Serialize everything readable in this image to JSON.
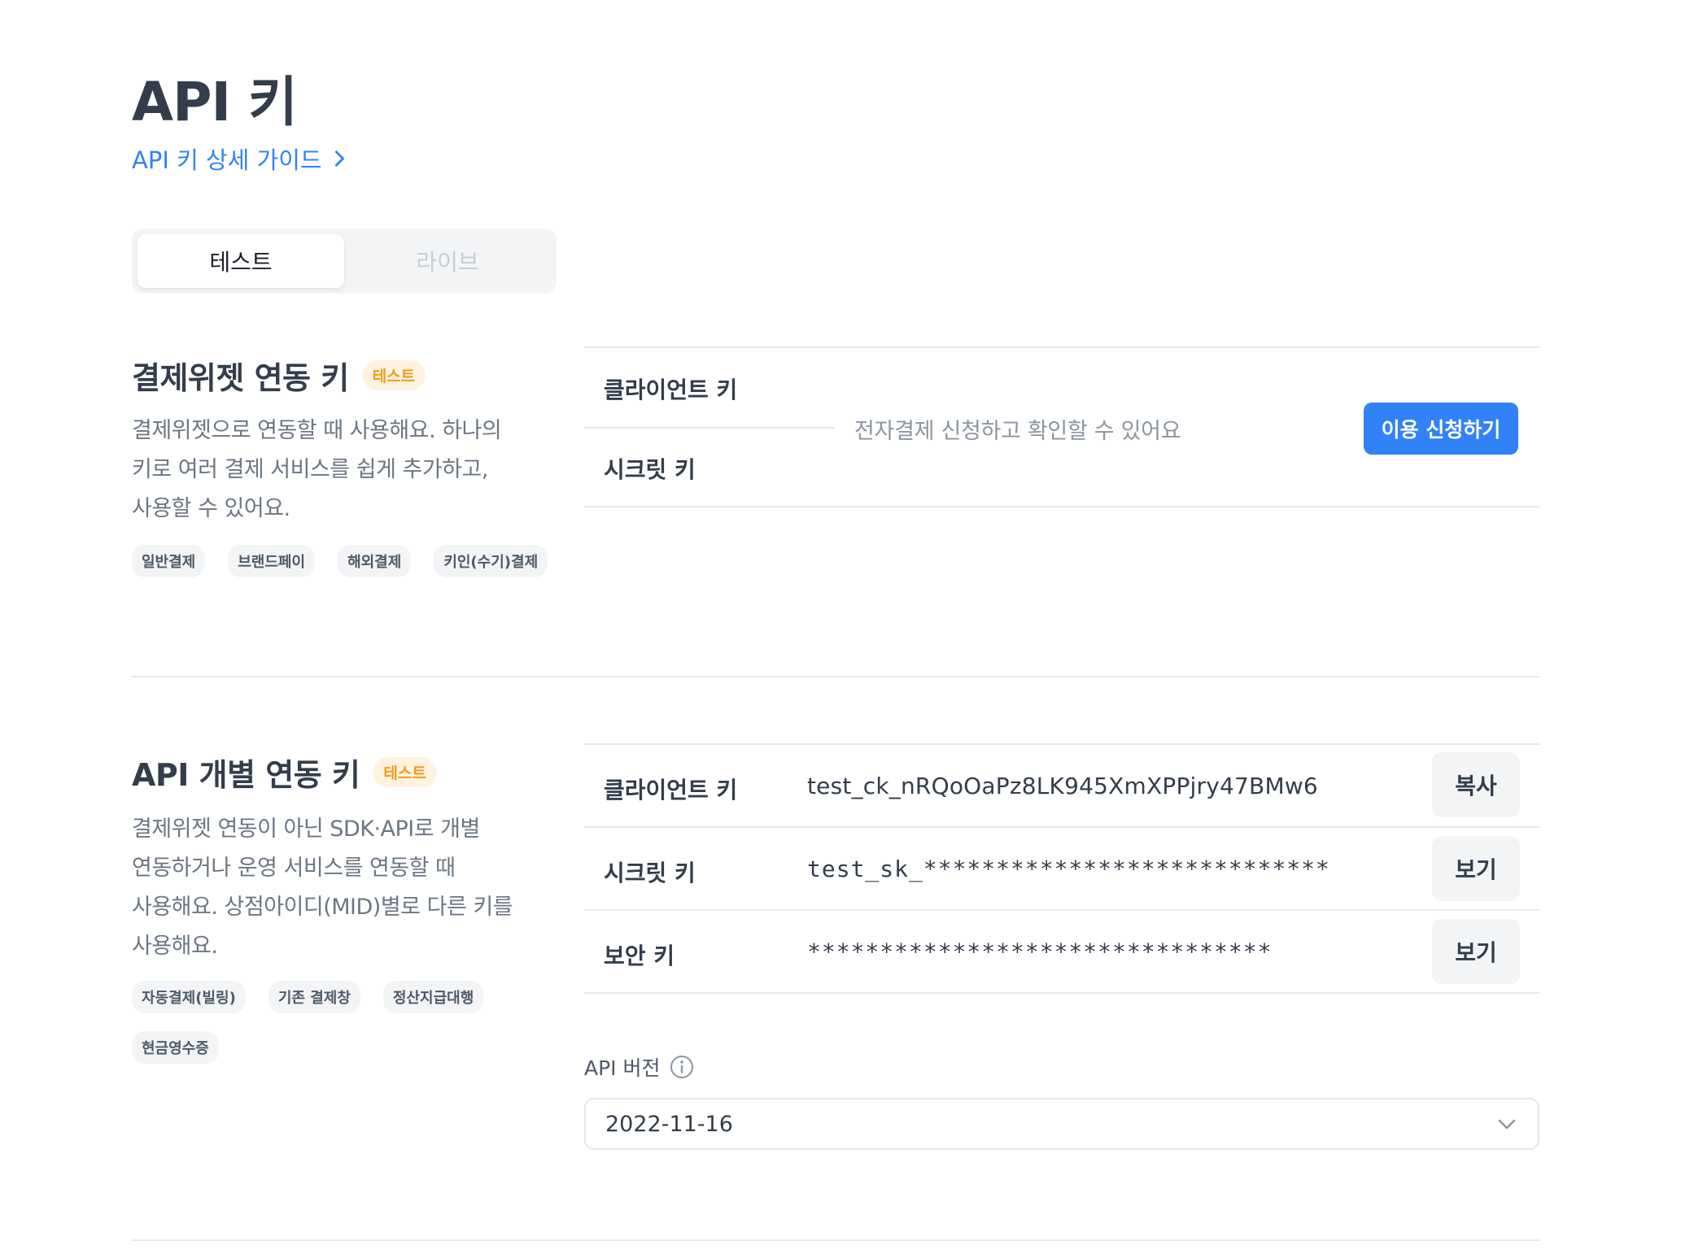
{
  "header": {
    "title": "API 키",
    "guide_link": "API 키 상세 가이드"
  },
  "env_tabs": {
    "test": "테스트",
    "live": "라이브"
  },
  "widget_section": {
    "title": "결제위젯 연동 키",
    "badge": "테스트",
    "description_lines": [
      "결제위젯으로 연동할 때 사용해요. 하나의",
      "키로 여러 결제 서비스를 쉽게 추가하고,",
      "사용할 수 있어요."
    ],
    "chips": [
      "일반결제",
      "브랜드페이",
      "해외결제",
      "키인(수기)결제"
    ],
    "client_key_label": "클라이언트 키",
    "secret_key_label": "시크릿 키",
    "notice": "전자결제 신청하고 확인할 수 있어요",
    "apply_button": "이용 신청하기"
  },
  "api_section": {
    "title": "API 개별 연동 키",
    "badge": "테스트",
    "description_lines": [
      "결제위젯 연동이 아닌 SDK·API로 개별",
      "연동하거나 운영 서비스를 연동할 때",
      "사용해요. 상점아이디(MID)별로 다른 키를",
      "사용해요."
    ],
    "chips": [
      "자동결제(빌링)",
      "기존 결제창",
      "정산지급대행",
      "현금영수증"
    ],
    "rows": [
      {
        "label": "클라이언트 키",
        "value": "test_ck_nRQoOaPz8LK945XmXPPjry47BMw6",
        "button": "복사"
      },
      {
        "label": "시크릿 키",
        "value": "test_sk_****************************",
        "button": "보기"
      },
      {
        "label": "보안 키",
        "value": "********************************",
        "button": "보기"
      }
    ],
    "version_label": "API 버전",
    "version_value": "2022-11-16"
  }
}
